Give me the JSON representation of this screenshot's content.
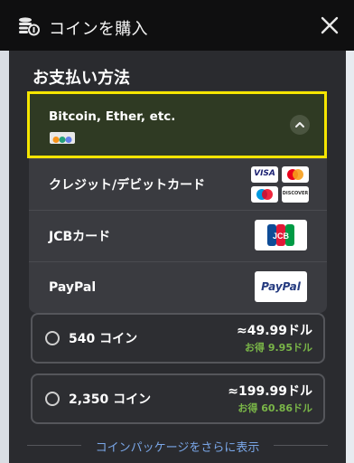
{
  "header": {
    "title": "コインを購入",
    "icon": "coins-cart-icon",
    "close_icon": "close-icon"
  },
  "payment": {
    "section_title": "お支払い方法",
    "crypto": {
      "label": "Bitcoin, Ether, etc.",
      "expanded_icon": "chevron-up-icon",
      "highlight_color": "#f5e500"
    },
    "methods": [
      {
        "label": "クレジット/デビットカード",
        "logos": [
          "VISA",
          "mastercard",
          "maestro",
          "DISCOVER"
        ]
      },
      {
        "label": "JCBカード",
        "logos": [
          "JCB"
        ]
      },
      {
        "label": "PayPal",
        "logos": [
          "PayPal"
        ]
      }
    ]
  },
  "coin_options": [
    {
      "amount": "540 コイン",
      "price": "≈49.99ドル",
      "saving": "お得 9.95ドル"
    },
    {
      "amount": "2,350 コイン",
      "price": "≈199.99ドル",
      "saving": "お得 60.86ドル"
    }
  ],
  "more_link": "コインパッケージをさらに表示",
  "colors": {
    "accent_green": "#7ab648",
    "link_blue": "#7aa7e8",
    "crypto_bg": "#2f3a23"
  }
}
